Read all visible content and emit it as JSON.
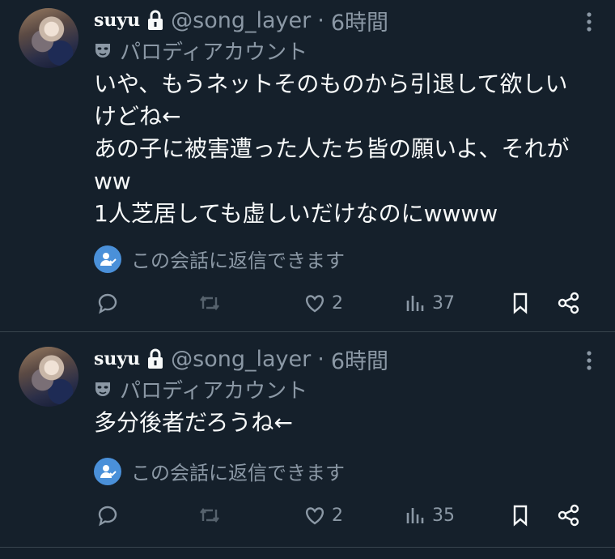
{
  "tweets": [
    {
      "name": "suyu",
      "handle": "@song_layer",
      "separator": "·",
      "time": "6時間",
      "parody_label": "パロディアカウント",
      "body": "いや、もうネットそのものから引退して欲しい\nけどね←\nあの子に被害遭った人たち皆の願いよ、それが\nww\n1人芝居しても虚しいだけなのにwwww",
      "reply_note": "この会話に返信できます",
      "likes": "2",
      "views": "37"
    },
    {
      "name": "suyu",
      "handle": "@song_layer",
      "separator": "·",
      "time": "6時間",
      "parody_label": "パロディアカウント",
      "body": "多分後者だろうね←",
      "reply_note": "この会話に返信できます",
      "likes": "2",
      "views": "35"
    }
  ],
  "icons": {
    "lock": "lock-icon",
    "more": "more-vertical-icon",
    "parody": "parody-mask-icon",
    "reply_badge": "user-check-badge-icon",
    "reply": "reply-icon",
    "retweet": "retweet-icon",
    "like": "heart-icon",
    "views": "views-icon",
    "bookmark": "bookmark-icon",
    "share": "share-icon"
  },
  "colors": {
    "background": "#15202b",
    "text": "#f7f9f9",
    "muted": "#8b98a5",
    "badge": "#4a90d9",
    "divider": "#38444d"
  }
}
